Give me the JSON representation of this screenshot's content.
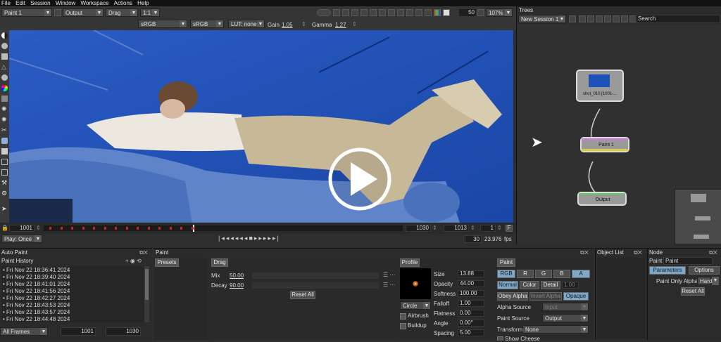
{
  "menu": [
    "File",
    "Edit",
    "Session",
    "Window",
    "Workspace",
    "Actions",
    "Help"
  ],
  "viewer": {
    "node_select": "Paint 1",
    "view_mode": "Output",
    "drag_mode": "Drag",
    "ratio": "1:1",
    "zoom": "107%",
    "stat_value": "50",
    "colorspace_in": "sRGB",
    "colorspace_out": "sRGB",
    "lut": "LUT: none",
    "gain_label": "Gain",
    "gain_value": "1.05",
    "gamma_label": "Gamma",
    "gamma_value": "1.27"
  },
  "timeline": {
    "start": "1001",
    "in_frame": "1030",
    "end_frame": "1013",
    "step": "1",
    "play_mode": "Play: Once",
    "frame": "30",
    "fps": "23.976",
    "fps_unit": "fps",
    "f_button": "F"
  },
  "trees": {
    "title": "Trees",
    "session": "New Session 1",
    "search_placeholder": "Search",
    "nodes": [
      {
        "label": "shot_010.[1001-..."
      },
      {
        "label": "Paint 1"
      },
      {
        "label": "Output"
      }
    ]
  },
  "autopaint": {
    "title": "Auto Paint",
    "history_title": "Paint History",
    "history": [
      "Fri Nov 22 18:36:41 2024",
      "Fri Nov 22 18:39:40 2024",
      "Fri Nov 22 18:41:01 2024",
      "Fri Nov 22 18:41:56 2024",
      "Fri Nov 22 18:42:27 2024",
      "Fri Nov 22 18:43:53 2024",
      "Fri Nov 22 18:43:57 2024",
      "Fri Nov 22 18:44:48 2024"
    ],
    "frames_mode": "All Frames",
    "from": "1001",
    "to": "1030"
  },
  "paint": {
    "title": "Paint",
    "presets": "Presets",
    "drag_tab": "Drag",
    "mix_label": "Mix",
    "mix_value": "50.00",
    "decay_label": "Decay",
    "decay_value": "90.00",
    "reset_all": "Reset All",
    "profile_tab": "Profile",
    "brush_shape": "Circle",
    "airbrush": "Airbrush",
    "buildup": "Buildup",
    "params": [
      {
        "label": "Size",
        "value": "13.88"
      },
      {
        "label": "Opacity",
        "value": "44.00"
      },
      {
        "label": "Softness",
        "value": "100.00"
      },
      {
        "label": "Falloff",
        "value": "1.00"
      },
      {
        "label": "Flatness",
        "value": "0.00"
      },
      {
        "label": "Angle",
        "value": "0.00°"
      },
      {
        "label": "Spacing",
        "value": "5.00"
      }
    ],
    "paint_tab": "Paint",
    "channels": [
      "RGB",
      "R",
      "G",
      "B",
      "A"
    ],
    "modes": [
      "Normal",
      "Color",
      "Detail"
    ],
    "detail_value": "1.00",
    "alpha_buttons": [
      "Obey Alpha",
      "Invert Alpha",
      "Opaque"
    ],
    "alpha_source_label": "Alpha Source",
    "alpha_source_value": "Input",
    "paint_source_label": "Paint Source",
    "paint_source_value": "Output",
    "transform_label": "Transform",
    "transform_value": "None",
    "show_cheese": "Show Cheese"
  },
  "objectlist": {
    "title": "Object List"
  },
  "nodepanel": {
    "title": "Node",
    "node_type": "Paint",
    "node_name": "Paint",
    "tab_parameters": "Parameters",
    "tab_options": "Options",
    "paint_only_alpha": "Paint Only Alpha",
    "alpha_mode": "Hard",
    "reset_all": "Reset All"
  },
  "colors": {
    "accent": "#7fa8c8",
    "bluescreen": "#1f52b8",
    "keyframe": "#d02020"
  }
}
